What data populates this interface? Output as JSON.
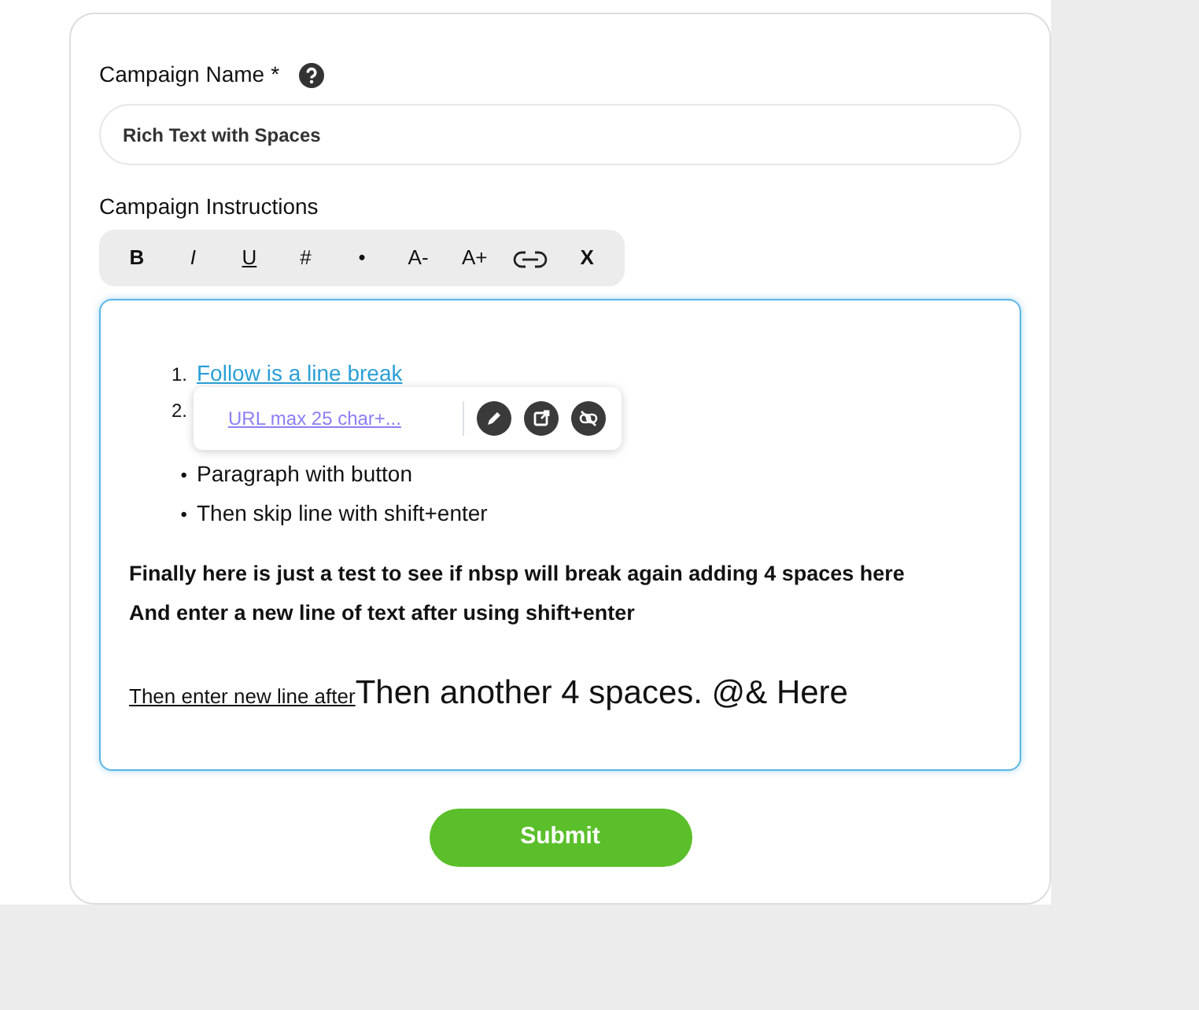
{
  "campaign_name": {
    "label": "Campaign Name",
    "required_mark": "*",
    "value": "Rich Text with Spaces"
  },
  "instructions": {
    "label": "Campaign Instructions",
    "toolbar": [
      {
        "kind": "bold",
        "label": "B"
      },
      {
        "kind": "italic",
        "label": "I"
      },
      {
        "kind": "underline",
        "label": "U"
      },
      {
        "kind": "text",
        "label": "#"
      },
      {
        "kind": "text",
        "label": "•"
      },
      {
        "kind": "text",
        "label": "A-"
      },
      {
        "kind": "text",
        "label": "A+"
      },
      {
        "kind": "link"
      },
      {
        "kind": "bold",
        "label": "X"
      }
    ],
    "ordered_list": [
      {
        "marker": "1.",
        "text": "Follow is a line break",
        "kind": "link"
      },
      {
        "marker": "2."
      }
    ],
    "link_popover": {
      "url": "URL max 25 char+..."
    },
    "bullet_list": [
      {
        "marker": "•",
        "text": "Paragraph with button"
      },
      {
        "marker": "•",
        "text": "Then skip line with shift+enter"
      }
    ],
    "bold_lines": [
      "Finally here is just a test to see if nbsp will break again adding 4 spaces here",
      "And enter a new line of text after using shift+enter"
    ],
    "last_line": {
      "underlined": "Then enter new line after",
      "large": "Then another 4 spaces. @& Here"
    }
  },
  "submit": "Submit"
}
